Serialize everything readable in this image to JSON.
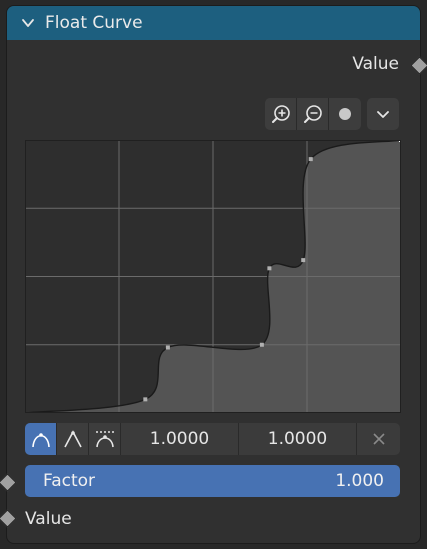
{
  "node": {
    "title": "Float Curve",
    "output_label": "Value",
    "input_label": "Value",
    "header_color": "#1d5f7f"
  },
  "curve_toolbar": {
    "icons": [
      "zoom-in-icon",
      "zoom-out-icon",
      "clipping-dot-icon",
      "chevron-down-icon"
    ]
  },
  "handle_tools": {
    "icons": [
      "auto-handle-icon",
      "vector-handle-icon",
      "auto-clamped-handle-icon",
      "delete-point-icon"
    ],
    "x_value": "1.0000",
    "y_value": "1.0000"
  },
  "factor": {
    "label": "Factor",
    "value": "1.000",
    "color": "#4772b3"
  },
  "curve": {
    "points": [
      [
        0.32,
        0.05
      ],
      [
        0.38,
        0.24
      ],
      [
        0.63,
        0.25
      ],
      [
        0.65,
        0.53
      ],
      [
        0.74,
        0.56
      ],
      [
        0.76,
        0.93
      ],
      [
        1.0,
        1.0
      ]
    ]
  }
}
